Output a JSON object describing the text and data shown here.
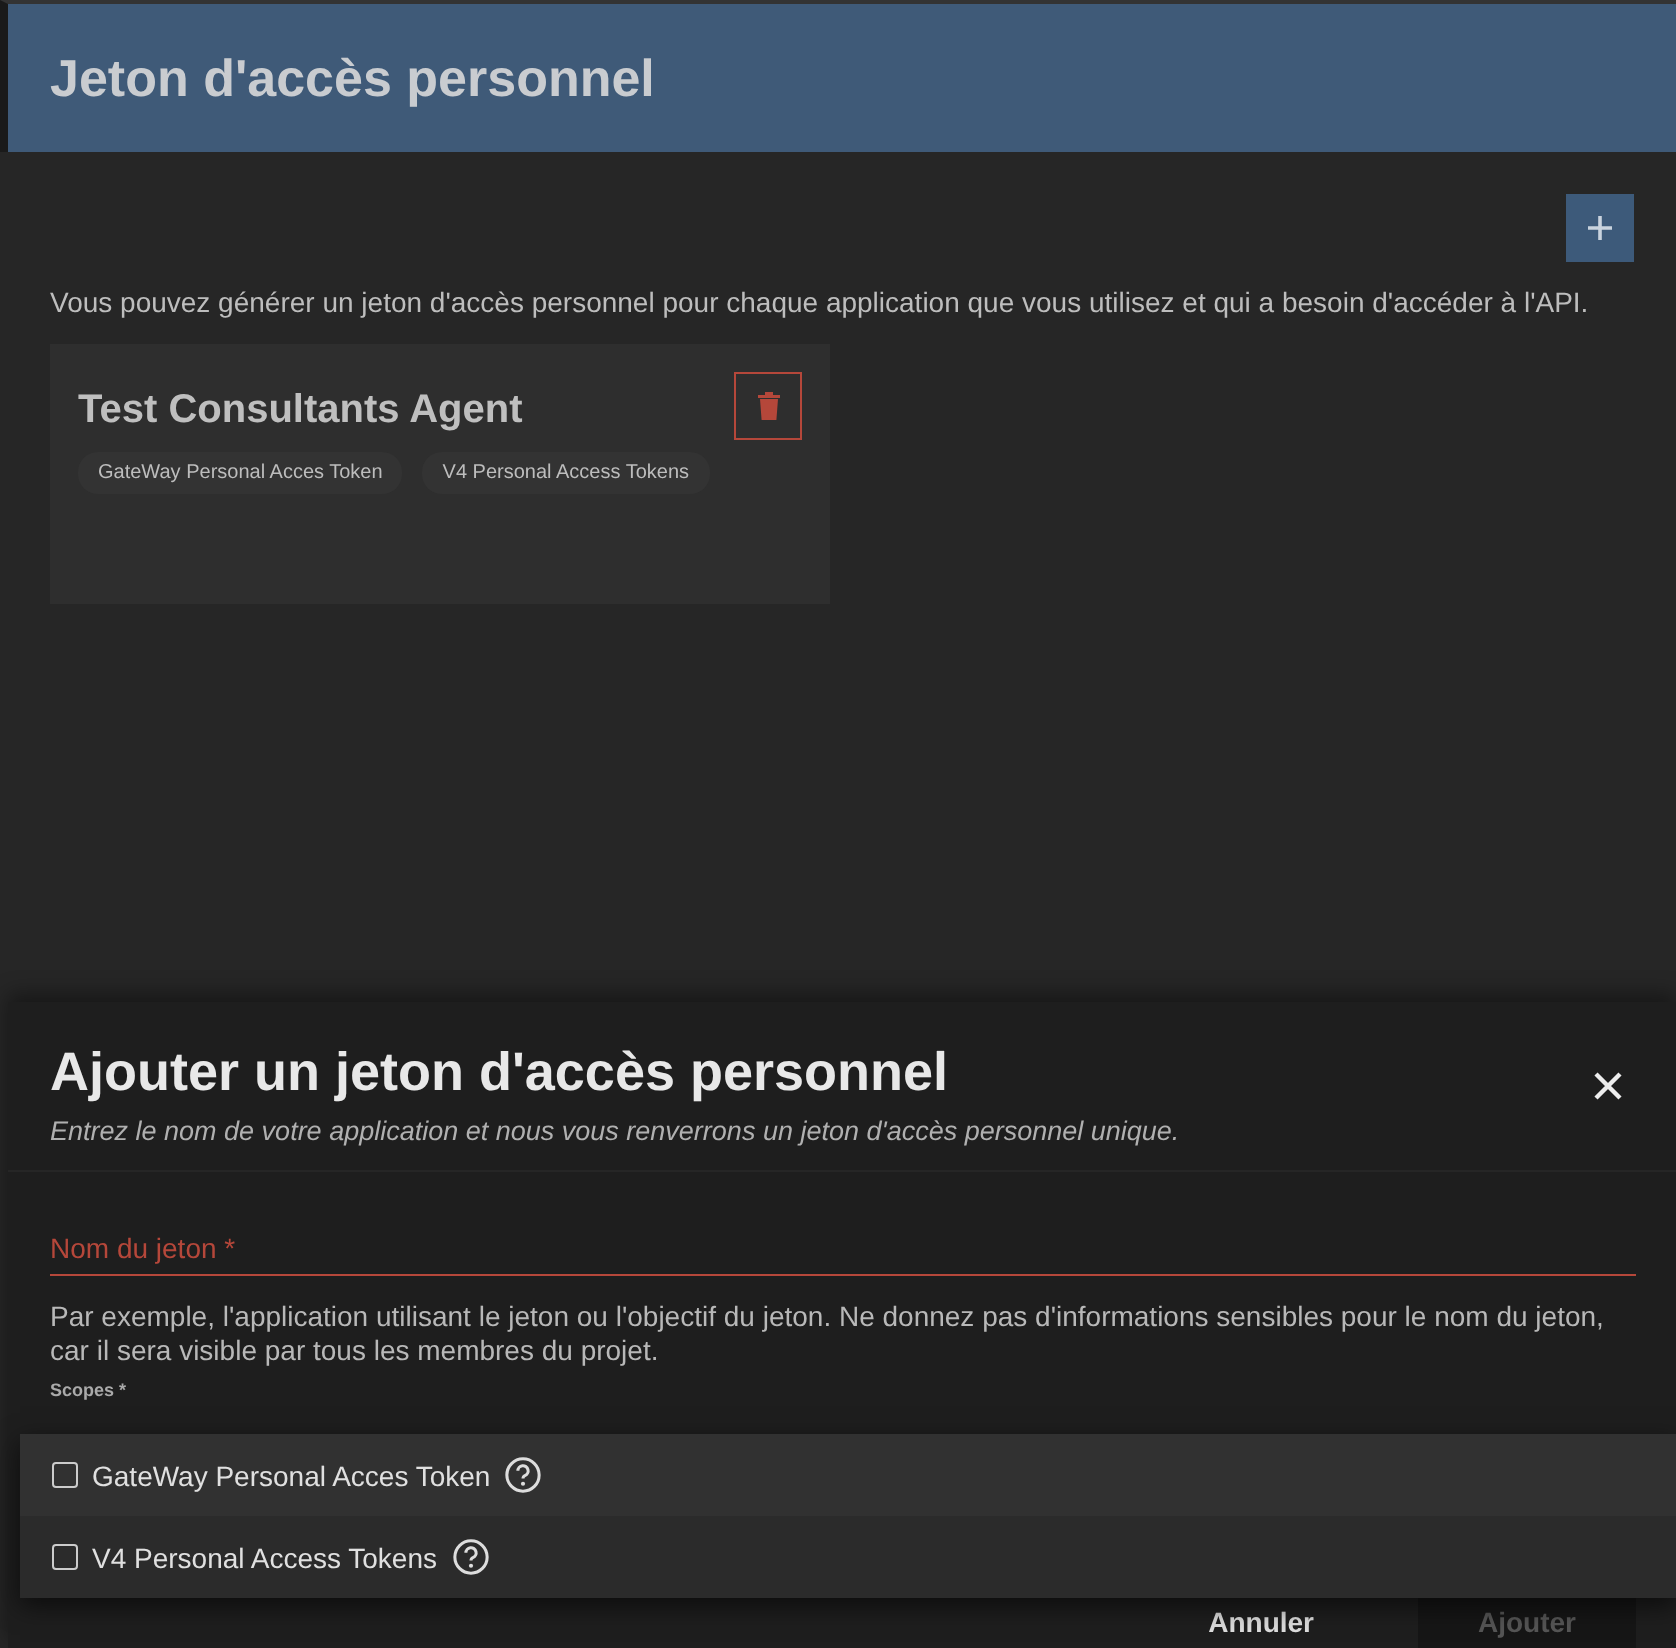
{
  "page": {
    "title": "Jeton d'accès personnel",
    "description": "Vous pouvez générer un jeton d'accès personnel pour chaque application que vous utilisez et qui a besoin d'accéder à l'API."
  },
  "tokens": [
    {
      "name": "Test Consultants Agent",
      "scopes": [
        "GateWay Personal Acces Token",
        "V4 Personal Access Tokens"
      ]
    }
  ],
  "dialog": {
    "title": "Ajouter un jeton d'accès personnel",
    "subtitle": "Entrez le nom de votre application et nous vous renverrons un jeton d'accès personnel unique.",
    "name_field": {
      "placeholder": "Nom du jeton *",
      "invalid": true
    },
    "helper": "Par exemple, l'application utilisant le jeton ou l'objectif du jeton. Ne donnez pas d'informations sensibles pour le nom du jeton, car il sera visible par tous les membres du projet.",
    "scopes_label": "Scopes *",
    "buttons": [
      {
        "label": "Annuler",
        "kind": "text",
        "disabled": false
      },
      {
        "label": "Ajouter",
        "kind": "filled",
        "disabled": true
      }
    ]
  },
  "scope_menu": [
    {
      "label": "GateWay Personal Acces Token",
      "checked": false
    },
    {
      "label": "V4 Personal Access Tokens",
      "checked": false
    }
  ]
}
